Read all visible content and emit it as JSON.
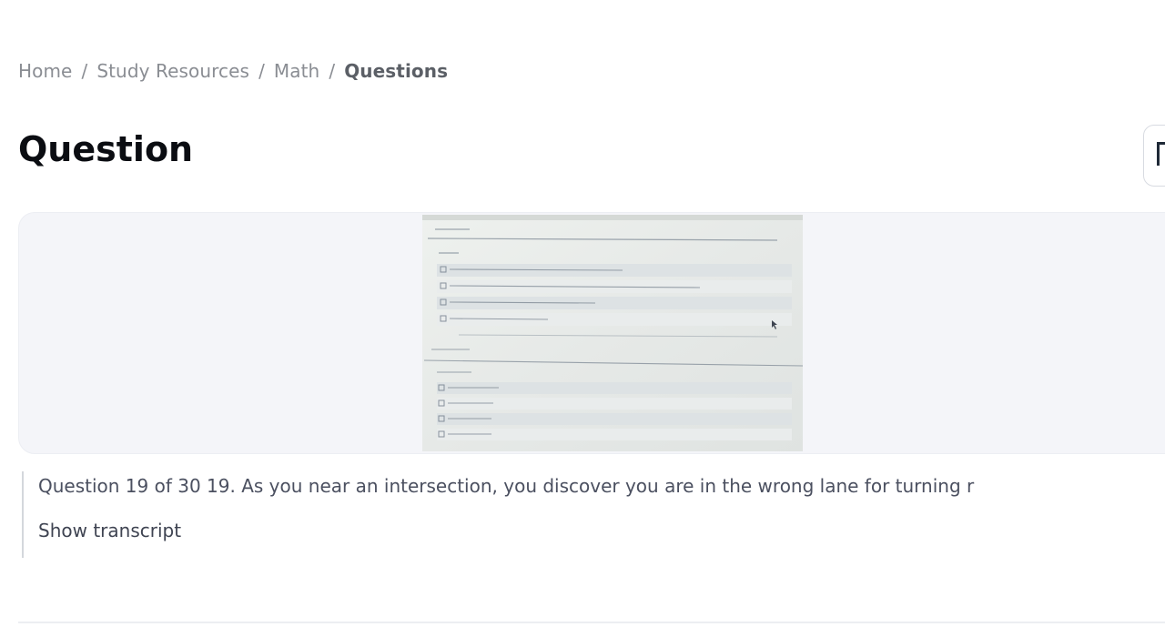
{
  "breadcrumb": {
    "items": [
      "Home",
      "Study Resources",
      "Math"
    ],
    "current": "Questions",
    "separator": "/"
  },
  "page": {
    "title": "Question"
  },
  "question": {
    "text": "Question 19 of 30 19. As you near an intersection, you discover you are in the wrong lane for turning r",
    "show_transcript_label": "Show transcript"
  },
  "colors": {
    "card_background": "#f4f5f9",
    "title": "#0b0d12",
    "breadcrumb": "#8a8d93",
    "body_text": "#4b5060"
  }
}
